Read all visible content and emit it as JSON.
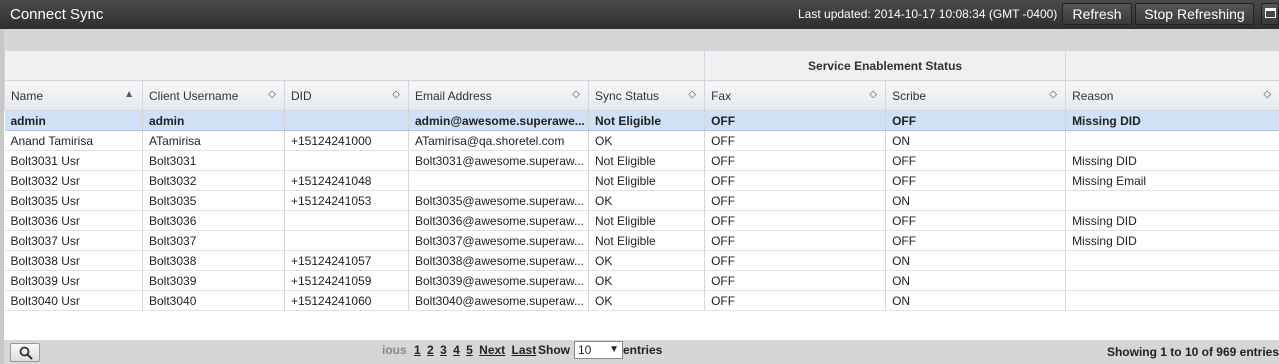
{
  "window": {
    "title": "Connect Sync",
    "last_updated": "Last updated: 2014-10-17 10:08:34 (GMT -0400)",
    "refresh_label": "Refresh",
    "stop_label": "Stop Refreshing"
  },
  "table": {
    "group_header": "Service Enablement Status",
    "columns": [
      {
        "label": "Name",
        "sort": "▲"
      },
      {
        "label": "Client Username",
        "sort": "◇"
      },
      {
        "label": "DID",
        "sort": "◇"
      },
      {
        "label": "Email Address",
        "sort": "◇"
      },
      {
        "label": "Sync Status",
        "sort": "◇"
      },
      {
        "label": "Fax",
        "sort": "◇"
      },
      {
        "label": "Scribe",
        "sort": "◇"
      },
      {
        "label": "Reason",
        "sort": "◇"
      }
    ],
    "rows": [
      [
        "admin",
        "admin",
        "",
        "admin@awesome.superawe...",
        "Not Eligible",
        "OFF",
        "OFF",
        "Missing DID"
      ],
      [
        "Anand Tamirisa",
        "ATamirisa",
        "+15124241000",
        "ATamirisa@qa.shoretel.com",
        "OK",
        "OFF",
        "ON",
        ""
      ],
      [
        "Bolt3031 Usr",
        "Bolt3031",
        "",
        "Bolt3031@awesome.superaw...",
        "Not Eligible",
        "OFF",
        "OFF",
        "Missing DID"
      ],
      [
        "Bolt3032 Usr",
        "Bolt3032",
        "+15124241048",
        "",
        "Not Eligible",
        "OFF",
        "OFF",
        "Missing Email"
      ],
      [
        "Bolt3035 Usr",
        "Bolt3035",
        "+15124241053",
        "Bolt3035@awesome.superaw...",
        "OK",
        "OFF",
        "ON",
        ""
      ],
      [
        "Bolt3036 Usr",
        "Bolt3036",
        "",
        "Bolt3036@awesome.superaw...",
        "Not Eligible",
        "OFF",
        "OFF",
        "Missing DID"
      ],
      [
        "Bolt3037 Usr",
        "Bolt3037",
        "",
        "Bolt3037@awesome.superaw...",
        "Not Eligible",
        "OFF",
        "OFF",
        "Missing DID"
      ],
      [
        "Bolt3038 Usr",
        "Bolt3038",
        "+15124241057",
        "Bolt3038@awesome.superaw...",
        "OK",
        "OFF",
        "ON",
        ""
      ],
      [
        "Bolt3039 Usr",
        "Bolt3039",
        "+15124241059",
        "Bolt3039@awesome.superaw...",
        "OK",
        "OFF",
        "ON",
        ""
      ],
      [
        "Bolt3040 Usr",
        "Bolt3040",
        "+15124241060",
        "Bolt3040@awesome.superaw...",
        "OK",
        "OFF",
        "ON",
        ""
      ]
    ]
  },
  "footer": {
    "prev_partial": "ious",
    "pages": [
      "1",
      "2",
      "3",
      "4",
      "5"
    ],
    "next_label": "Next",
    "last_label": "Last",
    "show_label": "Show",
    "page_size": "10",
    "entries_label": "entries",
    "summary": "Showing 1 to 10 of 969 entries"
  },
  "icons": {
    "search": "search-icon",
    "maximize": "maximize-icon"
  }
}
